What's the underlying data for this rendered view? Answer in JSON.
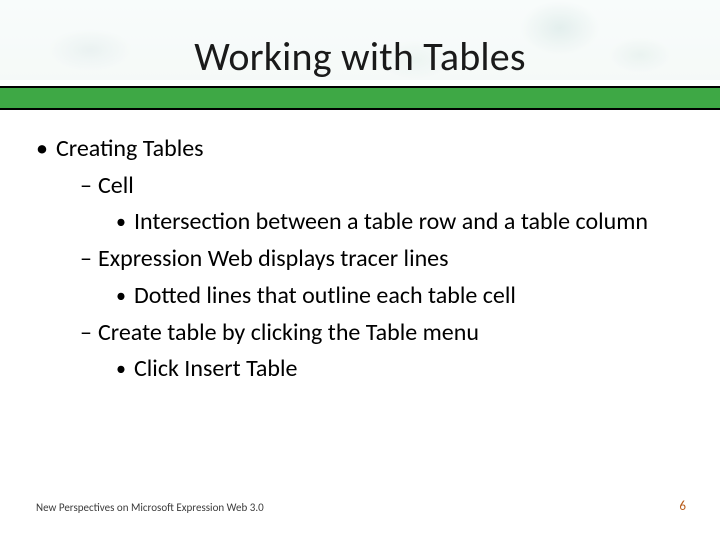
{
  "title": "Working with Tables",
  "bullets": {
    "l1_a": "Creating Tables",
    "l2_a": "Cell",
    "l3_a": "Intersection between a table row and a table column",
    "l2_b": "Expression Web displays tracer lines",
    "l3_b": "Dotted lines that outline each table cell",
    "l2_c": "Create table by clicking the Table menu",
    "l3_c": "Click Insert Table"
  },
  "footer": {
    "source": "New Perspectives on Microsoft Expression Web 3.0",
    "page": "6"
  }
}
